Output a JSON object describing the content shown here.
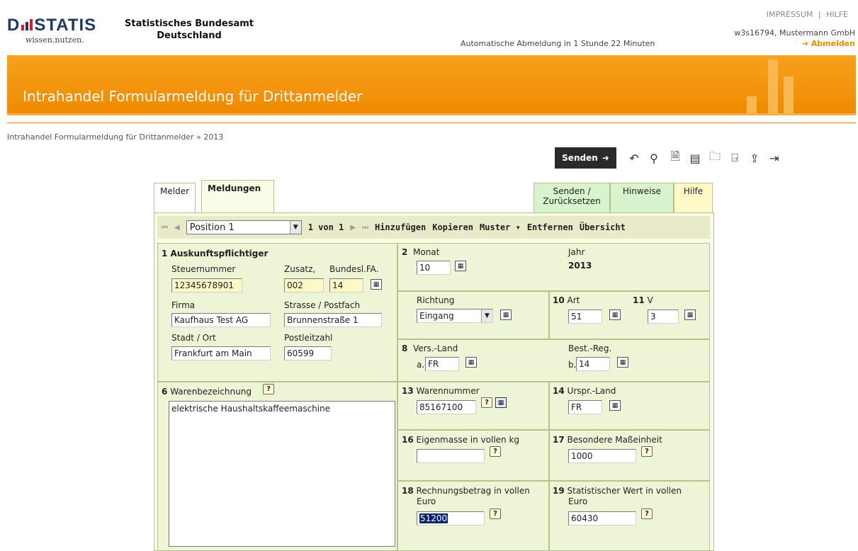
{
  "header": {
    "logo_text": "DESTATIS",
    "logo_tagline": "wissen.nutzen.",
    "agency_line1": "Statistisches Bundesamt",
    "agency_line2": "Deutschland",
    "auto_logout": "Automatische Abmeldung in 1 Stunde 22 Minuten",
    "impressum": "IMPRESSUM",
    "separator": "|",
    "hilfe": "HILFE",
    "user": "w3s16794, Mustermann GmbH",
    "abmelden": "➜ Abmelden",
    "title": "Intrahandel Formularmeldung für Drittanmelder"
  },
  "breadcrumb": "Intrahandel Formularmeldung für Drittanmelder » 2013",
  "toolbar": {
    "send_label": "Senden",
    "icons": [
      "undo-icon",
      "search-icon",
      "print-preview-icon",
      "save-icon",
      "open-folder-icon",
      "export-icon",
      "upload-icon",
      "exit-icon"
    ]
  },
  "tabs": {
    "melder": "Melder",
    "meldungen": "Meldungen",
    "senden_line1": "Senden /",
    "senden_line2": "Zurücksetzen",
    "hinweise": "Hinweise",
    "hilfe": "Hilfe"
  },
  "nav": {
    "position": "Position 1",
    "count": "1 von 1",
    "add": "Hinzufügen",
    "copy": "Kopieren",
    "template": "Muster ▾",
    "remove": "Entfernen",
    "overview": "Übersicht"
  },
  "form": {
    "s1": {
      "num": "1",
      "title": "Auskunftspflichtiger",
      "steuer_label": "Steuernummer",
      "steuer_value": "12345678901",
      "zusatz_label": "Zusatz,",
      "zusatz_value": "002",
      "bundesl_label": "Bundesl.FA.",
      "bundesl_value": "14",
      "firma_label": "Firma",
      "firma_value": "Kaufhaus Test AG",
      "strasse_label": "Strasse / Postfach",
      "strasse_value": "Brunnenstraße 1",
      "stadt_label": "Stadt / Ort",
      "stadt_value": "Frankfurt am Main",
      "plz_label": "Postleitzahl",
      "plz_value": "60599"
    },
    "s2": {
      "num": "2",
      "label": "Monat",
      "value": "10",
      "jahr_label": "Jahr",
      "jahr_value": "2013"
    },
    "richtung": {
      "label": "Richtung",
      "value": "Eingang"
    },
    "s10": {
      "num": "10",
      "label": "Art",
      "value": "51"
    },
    "s11": {
      "num": "11",
      "label": "V",
      "value": "3"
    },
    "s8": {
      "num": "8",
      "label": "Vers.-Land",
      "prefix": "a.",
      "value": "FR",
      "best_label": "Best.-Reg.",
      "best_prefix": "b.",
      "best_value": "14"
    },
    "s6": {
      "num": "6",
      "label": "Warenbezeichnung",
      "value": "elektrische Haushaltskaffeemaschine"
    },
    "s13": {
      "num": "13",
      "label": "Warennummer",
      "value": "85167100"
    },
    "s14": {
      "num": "14",
      "label": "Urspr.-Land",
      "value": "FR"
    },
    "s16": {
      "num": "16",
      "label": "Eigenmasse in vollen kg",
      "value": ""
    },
    "s17": {
      "num": "17",
      "label": "Besondere Maßeinheit",
      "value": "1000"
    },
    "s18": {
      "num": "18",
      "label_line1": "Rechnungsbetrag in vollen",
      "label_line2": "Euro",
      "value": "51200"
    },
    "s19": {
      "num": "19",
      "label_line1": "Statistischer Wert in vollen",
      "label_line2": "Euro",
      "value": "60430"
    }
  },
  "colors": {
    "accent": "#f08a00",
    "panel_bg": "#eef5d6",
    "highlight": "#0a246a"
  }
}
